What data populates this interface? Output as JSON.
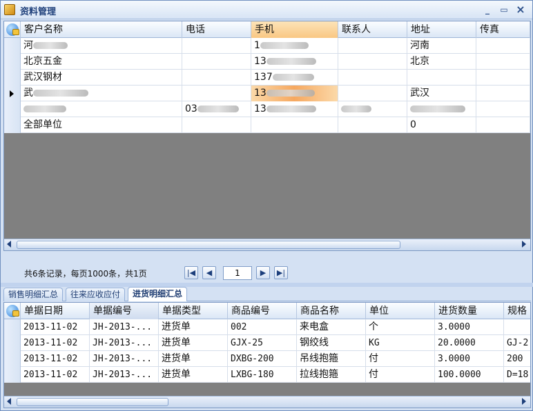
{
  "window": {
    "title": "资料管理",
    "min": "_",
    "max": "▭",
    "close": "×"
  },
  "grid1": {
    "columns": [
      "客户名称",
      "电话",
      "手机",
      "联系人",
      "地址",
      "传真"
    ],
    "rows": [
      {
        "name": "河",
        "phone": "",
        "mobile": "1",
        "contact": "",
        "address": "河南",
        "fax": ""
      },
      {
        "name": "北京五金",
        "phone": "",
        "mobile": "13",
        "contact": "",
        "address": "北京",
        "fax": ""
      },
      {
        "name": "武汉钢材",
        "phone": "",
        "mobile": "137",
        "contact": "",
        "address": "",
        "fax": ""
      },
      {
        "name": "武",
        "phone": "",
        "mobile": "13",
        "contact": "",
        "address": "武汉",
        "fax": ""
      },
      {
        "name": "",
        "phone": "03",
        "mobile": "13",
        "contact": "",
        "address": "",
        "fax": ""
      },
      {
        "name": "全部单位",
        "phone": "",
        "mobile": "",
        "contact": "",
        "address": "0",
        "fax": ""
      }
    ]
  },
  "pager": {
    "info": "共6条记录，每页1000条，共1页",
    "page": "1",
    "first": "|◀",
    "prev": "◀",
    "next": "▶",
    "last": "▶|"
  },
  "tabs": [
    "销售明细汇总",
    "往来应收应付",
    "进货明细汇总"
  ],
  "grid2": {
    "columns": [
      "单据日期",
      "单据编号",
      "单据类型",
      "商品编号",
      "商品名称",
      "单位",
      "进货数量",
      "规格"
    ],
    "rows": [
      {
        "date": "2013-11-02",
        "no": "JH-2013-...",
        "type": "进货单",
        "code": "002",
        "name": "来电盒",
        "unit": "个",
        "qty": "3.0000",
        "spec": ""
      },
      {
        "date": "2013-11-02",
        "no": "JH-2013-...",
        "type": "进货单",
        "code": "GJX-25",
        "name": "钢绞线",
        "unit": "KG",
        "qty": "20.0000",
        "spec": "GJ-2"
      },
      {
        "date": "2013-11-02",
        "no": "JH-2013-...",
        "type": "进货单",
        "code": "DXBG-200",
        "name": "吊线抱箍",
        "unit": "付",
        "qty": "3.0000",
        "spec": "200"
      },
      {
        "date": "2013-11-02",
        "no": "JH-2013-...",
        "type": "进货单",
        "code": "LXBG-180",
        "name": "拉线抱箍",
        "unit": "付",
        "qty": "100.0000",
        "spec": "D=18"
      }
    ]
  },
  "colors": {
    "accent": "#f6a860",
    "frame": "#6f8fbf",
    "empty": "#808080"
  }
}
